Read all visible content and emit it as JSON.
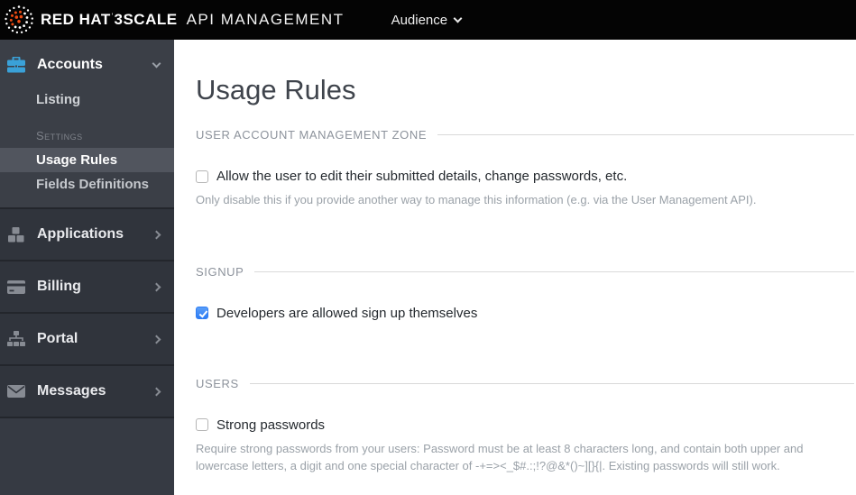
{
  "header": {
    "brand_bold": "RED HAT",
    "brand_tm": "'",
    "brand_bold2": "3SCALE",
    "brand_light": "API MANAGEMENT",
    "audience_label": "Audience"
  },
  "sidebar": {
    "accounts": {
      "label": "Accounts",
      "icon": "briefcase-icon"
    },
    "listing_label": "Listing",
    "settings_header": "Settings",
    "settings_items": [
      {
        "label": "Usage Rules",
        "selected": true
      },
      {
        "label": "Fields Definitions",
        "selected": false
      }
    ],
    "nav": [
      {
        "label": "Applications",
        "icon": "cubes-icon"
      },
      {
        "label": "Billing",
        "icon": "credit-card-icon"
      },
      {
        "label": "Portal",
        "icon": "sitemap-icon"
      },
      {
        "label": "Messages",
        "icon": "envelope-icon"
      }
    ]
  },
  "main": {
    "title": "Usage Rules",
    "sections": [
      {
        "legend": "USER ACCOUNT MANAGEMENT ZONE",
        "checkbox": {
          "checked": false,
          "label": "Allow the user to edit their submitted details, change passwords, etc."
        },
        "help": "Only disable this if you provide another way to manage this information (e.g. via the User Management API)."
      },
      {
        "legend": "SIGNUP",
        "checkbox": {
          "checked": true,
          "label": "Developers are allowed sign up themselves"
        }
      },
      {
        "legend": "USERS",
        "checkbox": {
          "checked": false,
          "label": "Strong passwords"
        },
        "help": "Require strong passwords from your users: Password must be at least 8 characters long, and contain both upper and lowercase letters, a digit and one special character of -+=><_$#.:;!?@&*()~][}{|. Existing passwords will still work."
      }
    ]
  },
  "colors": {
    "header_bg": "#040404",
    "sidebar_bg": "#30343c",
    "sidebar_top_bg": "#3b3f47",
    "sidebar_selected_bg": "#51555e",
    "accounts_icon_blue": "#3aa1d8",
    "checkbox_blue": "#2d7cf4",
    "logo_orange": "#ee4b12"
  }
}
